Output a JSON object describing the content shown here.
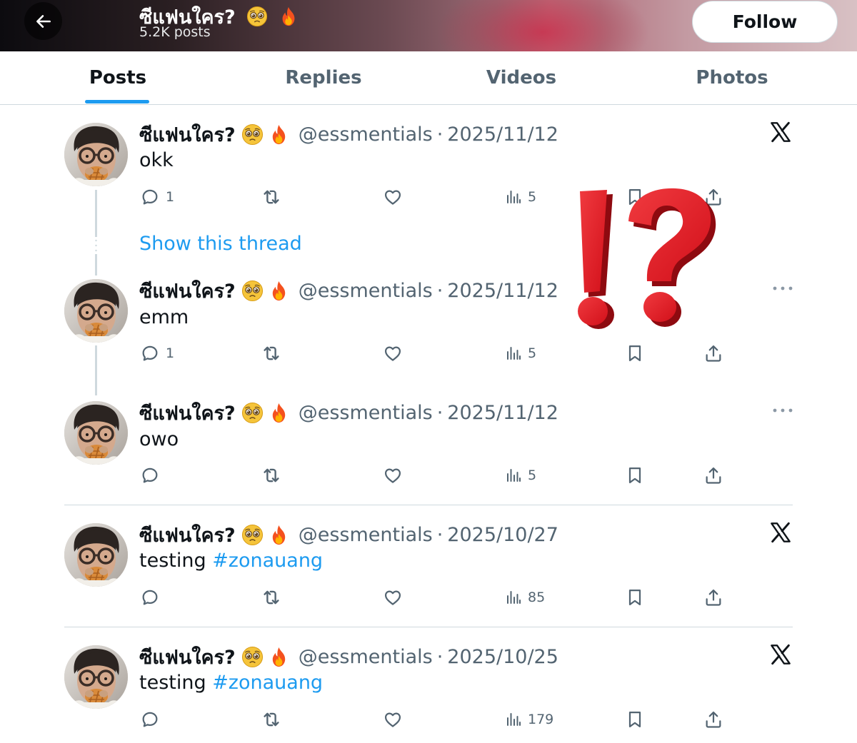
{
  "header": {
    "name": "ซีแฟนใคร?",
    "post_count": "5.2K posts",
    "follow_label": "Follow"
  },
  "tabs": [
    {
      "label": "Posts",
      "active": true
    },
    {
      "label": "Replies",
      "active": false
    },
    {
      "label": "Videos",
      "active": false
    },
    {
      "label": "Photos",
      "active": false
    }
  ],
  "show_thread_label": "Show this thread",
  "posts": [
    {
      "name": "ซีแฟนใคร?",
      "handle": "@essmentials",
      "date": "2025/11/12",
      "text": "okk",
      "hashtag": "",
      "replies": "1",
      "views": "5",
      "corner": "x-logo"
    },
    {
      "name": "ซีแฟนใคร?",
      "handle": "@essmentials",
      "date": "2025/11/12",
      "text": "emm",
      "hashtag": "",
      "replies": "1",
      "views": "5",
      "corner": "more"
    },
    {
      "name": "ซีแฟนใคร?",
      "handle": "@essmentials",
      "date": "2025/11/12",
      "text": "owo",
      "hashtag": "",
      "replies": "",
      "views": "5",
      "corner": "more"
    },
    {
      "name": "ซีแฟนใคร?",
      "handle": "@essmentials",
      "date": "2025/10/27",
      "text": "testing ",
      "hashtag": "#zonauang",
      "replies": "",
      "views": "85",
      "corner": "x-logo"
    },
    {
      "name": "ซีแฟนใคร?",
      "handle": "@essmentials",
      "date": "2025/10/25",
      "text": "testing ",
      "hashtag": "#zonauang",
      "replies": "",
      "views": "179",
      "corner": "x-logo"
    }
  ],
  "icons": {
    "back": "arrow-left-icon",
    "reply": "comment-icon",
    "retweet": "repost-icon",
    "like": "heart-icon",
    "views": "analytics-icon",
    "bookmark": "bookmark-icon",
    "share": "share-icon",
    "brand": "x-logo-icon",
    "overlay": "exclamation-question-mark-icon"
  },
  "colors": {
    "accent": "#1d9bf0",
    "text": "#0f1419",
    "muted": "#536471",
    "overlay_red": "#e3121e"
  }
}
